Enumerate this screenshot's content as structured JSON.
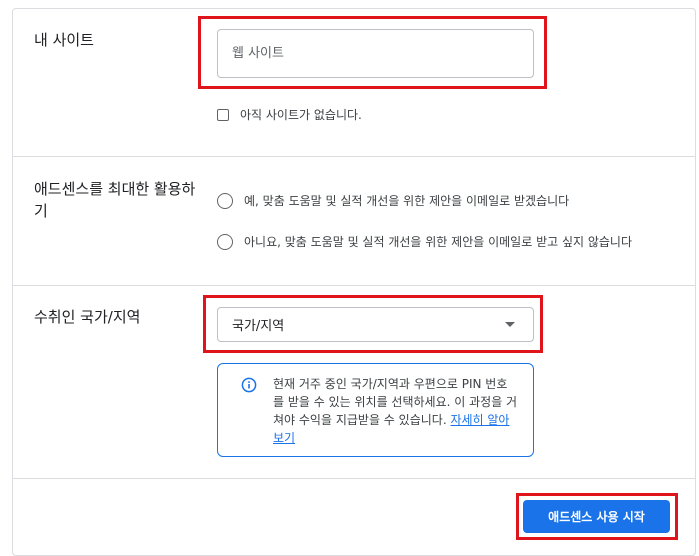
{
  "my_site": {
    "label": "내 사이트",
    "input_placeholder": "웹 사이트",
    "input_value": "",
    "no_site_checkbox_label": "아직 사이트가 없습니다."
  },
  "optimize": {
    "label": "애드센스를 최대한 활용하기",
    "option_yes": "예, 맞춤 도움말 및 실적 개선을 위한 제안을 이메일로 받겠습니다",
    "option_no": "아니요, 맞춤 도움말 및 실적 개선을 위한 제안을 이메일로 받고 싶지 않습니다"
  },
  "payee_country": {
    "label": "수취인 국가/지역",
    "select_value": "국가/지역",
    "info_text": "현재 거주 중인 국가/지역과 우편으로 PIN 번호를 받을 수 있는 위치를 선택하세요. 이 과정을 거쳐야 수익을 지급받을 수 있습니다. ",
    "info_link": "자세히 알아보기"
  },
  "actions": {
    "start_button": "애드센스 사용 시작"
  },
  "colors": {
    "accent": "#1a73e8",
    "highlight_border": "#e0141b"
  },
  "icons": {
    "info": "info-icon",
    "dropdown": "dropdown-caret-icon"
  }
}
